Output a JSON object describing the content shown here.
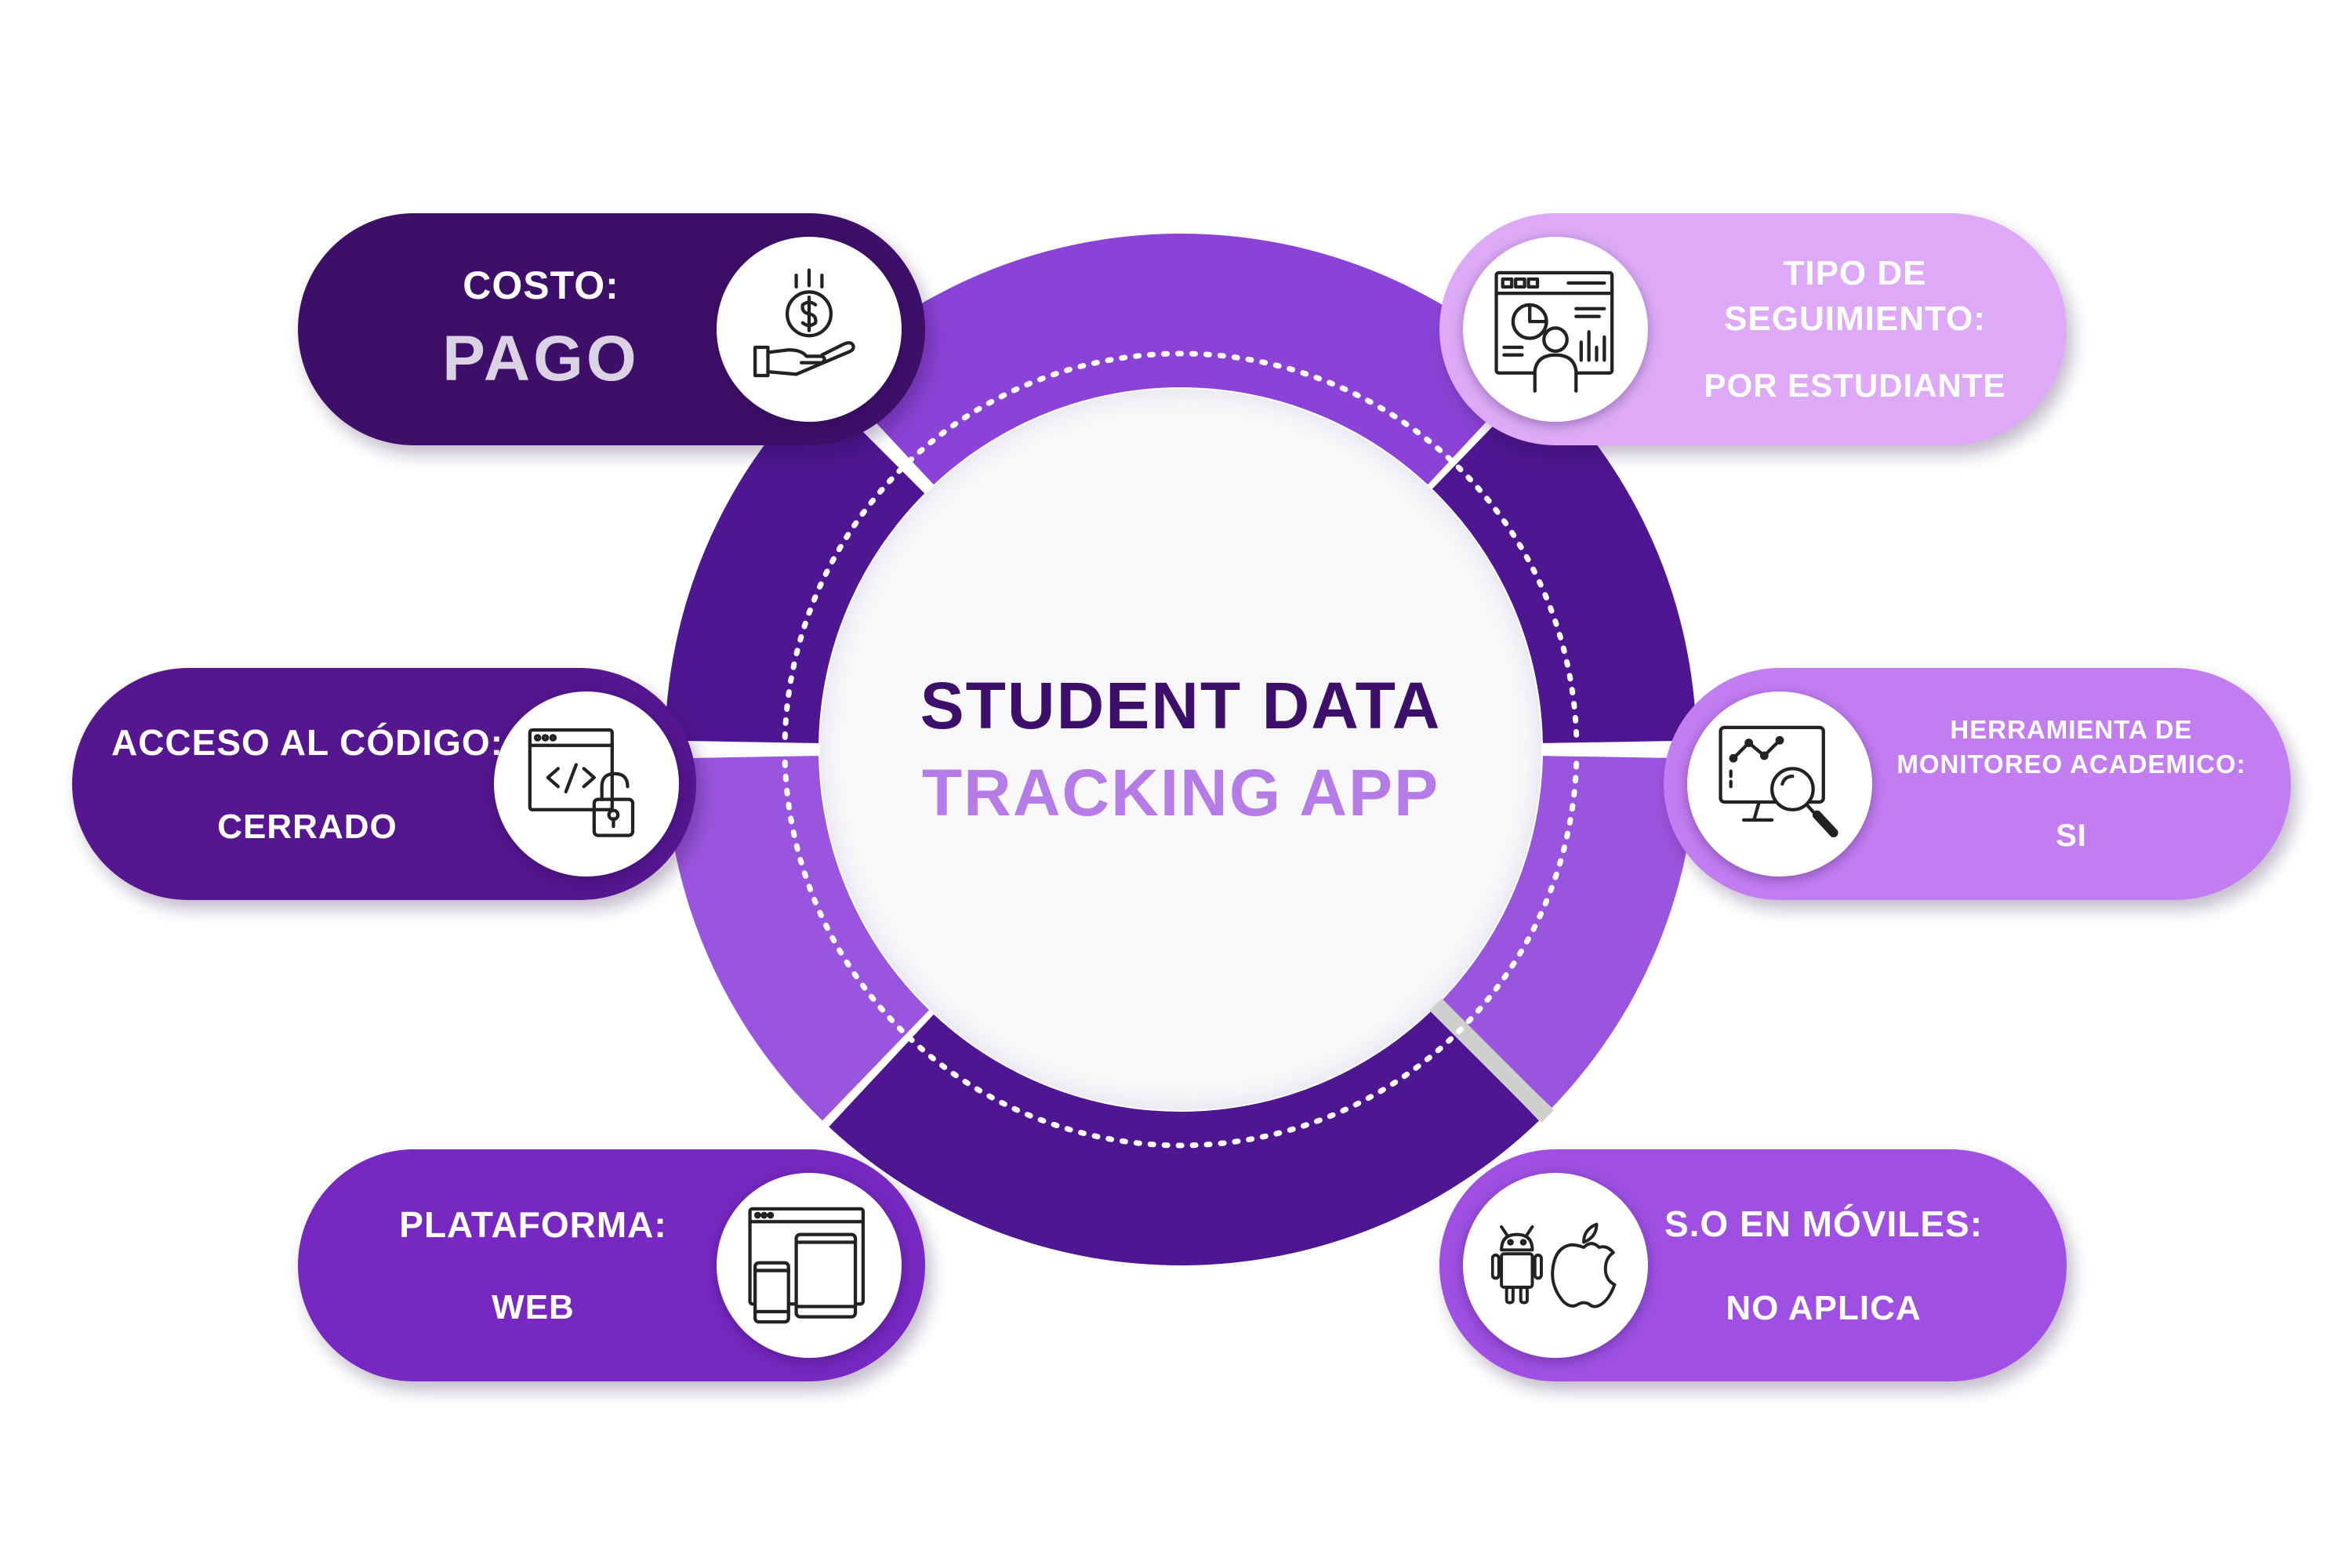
{
  "center": {
    "line1": "STUDENT DATA",
    "line2": "TRACKING APP"
  },
  "colors": {
    "ring_dark": "#4e1690",
    "ring_mid": "#8a43d6",
    "ring_light": "#9a55de",
    "center_title": "#3b0f6a",
    "center_subtitle": "#b57be6"
  },
  "cards": {
    "costo": {
      "label": "COSTO:",
      "value": "PAGO",
      "icon": "money-hand-icon",
      "color": "#3e0f68"
    },
    "acceso": {
      "label": "ACCESO AL CÓDIGO:",
      "value": "CERRADO",
      "icon": "code-lock-icon",
      "color": "#55168f"
    },
    "plataforma": {
      "label": "PLATAFORMA:",
      "value": "WEB",
      "icon": "devices-icon",
      "color": "#7628c0"
    },
    "tipo": {
      "label_line1": "TIPO DE",
      "label_line2": "SEGUIMIENTO:",
      "value": "POR ESTUDIANTE",
      "icon": "dashboard-user-icon",
      "color": "#deaaf8"
    },
    "herramienta": {
      "label_line1": "HERRAMIENTA DE",
      "label_line2": "MONITOREO ACADEMICO:",
      "value": "SI",
      "icon": "monitor-search-icon",
      "color": "#c27df1"
    },
    "so": {
      "label": "S.O EN MÓVILES:",
      "value": "NO APLICA",
      "icon": "android-apple-icon",
      "color": "#9f50e3"
    }
  }
}
